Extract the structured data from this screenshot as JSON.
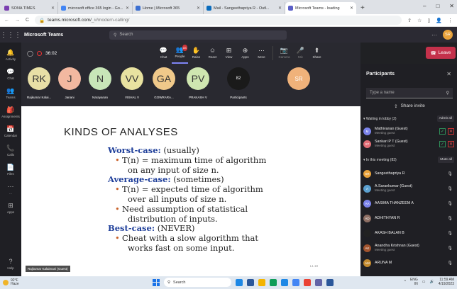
{
  "browser": {
    "tabs": [
      {
        "label": "SONA TIMES",
        "color": "#7b3fb0"
      },
      {
        "label": "microsoft office 365 login - Go...",
        "color": "#4285f4"
      },
      {
        "label": "Home | Microsoft 365",
        "color": "#3b6fd1"
      },
      {
        "label": "Mail - Sangeethapriya R - Outl...",
        "color": "#0a6cbd"
      },
      {
        "label": "Microsoft Teams - loading",
        "color": "#5b5fc7",
        "active": true
      }
    ],
    "new_tab": "+",
    "url_host": "teams.microsoft.com/",
    "url_path": "_#/modern-calling/"
  },
  "teams": {
    "brand": "Microsoft Teams",
    "search_placeholder": "Search",
    "me_initials": "SR",
    "rail": [
      {
        "label": "Activity",
        "icon": "bell-icon",
        "glyph": "🔔"
      },
      {
        "label": "Chat",
        "icon": "chat-icon",
        "glyph": "💬"
      },
      {
        "label": "Teams",
        "icon": "teams-icon",
        "glyph": "👥"
      },
      {
        "label": "Assignments",
        "icon": "assignments-icon",
        "glyph": "🎒"
      },
      {
        "label": "Calendar",
        "icon": "calendar-icon",
        "glyph": "📅"
      },
      {
        "label": "Calls",
        "icon": "phone-icon",
        "glyph": "📞"
      },
      {
        "label": "Files",
        "icon": "file-icon",
        "glyph": "📄"
      },
      {
        "label": "...",
        "icon": "more-icon",
        "glyph": "⋯"
      },
      {
        "label": "Apps",
        "icon": "apps-icon",
        "glyph": "⊞"
      }
    ],
    "help_label": "Help"
  },
  "call": {
    "timer": "36:02",
    "controls": [
      {
        "label": "Chat",
        "glyph": "💬",
        "icon": "chat-icon"
      },
      {
        "label": "People",
        "glyph": "👥",
        "icon": "people-icon",
        "badge": "83"
      },
      {
        "label": "Raise",
        "glyph": "✋",
        "icon": "raise-hand-icon"
      },
      {
        "label": "React",
        "glyph": "☺",
        "icon": "react-icon"
      },
      {
        "label": "View",
        "glyph": "⊞",
        "icon": "view-icon"
      },
      {
        "label": "Apps",
        "glyph": "⊕",
        "icon": "apps-icon"
      },
      {
        "label": "More",
        "glyph": "⋯",
        "icon": "more-icon"
      }
    ],
    "device_controls": [
      {
        "label": "Camera",
        "glyph": "📷",
        "icon": "camera-off-icon"
      },
      {
        "label": "Mic",
        "glyph": "🎤",
        "icon": "mic-off-icon"
      },
      {
        "label": "Share",
        "glyph": "⬆",
        "icon": "share-icon"
      }
    ],
    "leave_label": "Leave",
    "participants_strip": [
      {
        "initials": "RK",
        "name": "Rajkumar Kalai...",
        "color": "#e8dfa6"
      },
      {
        "initials": "J",
        "name": "Janani",
        "color": "#f2b8a0"
      },
      {
        "initials": "N",
        "name": "Narayanan",
        "color": "#c8e6b8"
      },
      {
        "initials": "VV",
        "name": "VISHAL V",
        "color": "#e8e2a0"
      },
      {
        "initials": "GA",
        "name": "GOWRARA...",
        "color": "#f0c98a"
      },
      {
        "initials": "PV",
        "name": "PRAKASH V",
        "color": "#cfe6b0"
      },
      {
        "initials": "82",
        "name": "Participants",
        "color": "#1a1a1a"
      }
    ],
    "self_initials": "SR",
    "self_color": "#f0b27a"
  },
  "slide": {
    "title": "KINDS OF ANALYSES",
    "worst_head": "Worst-case:",
    "worst_note": " (usually)",
    "worst_b1a": "T(n) = maximum time of algorithm",
    "worst_b1b": "on any input of size n.",
    "avg_head": "Average-case:",
    "avg_note": " (sometimes)",
    "avg_b1a": "T(n) = expected time of algorithm",
    "avg_b1b": "over all inputs of size n.",
    "avg_b2a": "Need assumption of statistical",
    "avg_b2b": "distribution of inputs.",
    "best_head": "Best-case:",
    "best_note": " (NEVER)",
    "best_b1a": "Cheat with a slow algorithm that",
    "best_b1b": "works fast on some input.",
    "presenter": "Rajkumar Kalaimani (Guest)",
    "page": "L1.18"
  },
  "panel": {
    "title": "Participants",
    "search_placeholder": "Type a name",
    "share_invite": "Share invite",
    "lobby_label": "Waiting in lobby (2)",
    "admit_all": "Admit all",
    "lobby": [
      {
        "initials": "M",
        "name": "Mathivanan (Guest)",
        "sub": "Meeting guest",
        "color": "#7b83eb"
      },
      {
        "initials": "ST",
        "name": "Sankari P T (Guest)",
        "sub": "Meeting guest",
        "color": "#e06c75"
      }
    ],
    "meeting_label": "In this meeting (83)",
    "mute_all": "Mute all",
    "members": [
      {
        "initials": "SR",
        "name": "Sangeethapriya R",
        "sub": "",
        "color": "#e8a23b"
      },
      {
        "initials": "A",
        "name": "A.Sarankumar (Guest)",
        "sub": "Meeting guest",
        "color": "#5ba0d0"
      },
      {
        "initials": "AA",
        "name": "AASIMA THANZEEM A",
        "sub": "",
        "color": "#7b83eb"
      },
      {
        "initials": "AD",
        "name": "ADHITHYAN R",
        "sub": "",
        "color": "#8d6e63"
      },
      {
        "initials": "",
        "name": "AKASH BALAN B",
        "sub": "",
        "color": "#222"
      },
      {
        "initials": "AK",
        "name": "Anandha Krishnan (Guest)",
        "sub": "Meeting guest",
        "color": "#a0522d"
      },
      {
        "initials": "AM",
        "name": "ARUNA M",
        "sub": "",
        "color": "#c38a2e"
      }
    ]
  },
  "taskbar": {
    "temp": "92°F",
    "weather": "Haze",
    "search": "Search",
    "lang": "ENG",
    "region": "IN",
    "time": "11:59 AM",
    "date": "4/19/2023",
    "apps": [
      "#1e88e5",
      "#2b579a",
      "#f4b400",
      "#0f9d58",
      "#1e88e5",
      "#4285f4",
      "#ea4335",
      "#6264a7",
      "#2b579a"
    ]
  }
}
